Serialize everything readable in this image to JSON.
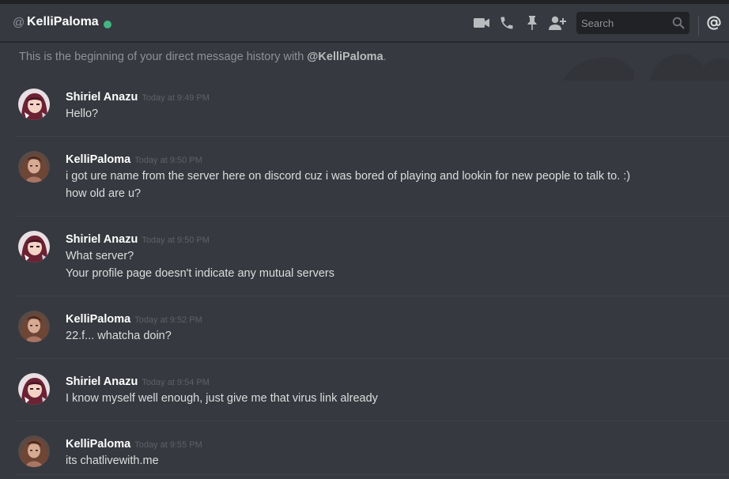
{
  "header": {
    "at_symbol": "@",
    "username": "KelliPaloma",
    "status_color": "#43b581",
    "icons": [
      "video-call-icon",
      "voice-call-icon",
      "pin-icon",
      "add-friend-icon",
      "mention-icon"
    ],
    "search_placeholder": "Search"
  },
  "intro": {
    "prefix": "This is the beginning of your direct message history with ",
    "mention": "@KelliPaloma",
    "suffix": "."
  },
  "messages": [
    {
      "author": "Shiriel Anazu",
      "timestamp": "Today at 9:49 PM",
      "lines": [
        "Hello?"
      ]
    },
    {
      "author": "KelliPaloma",
      "timestamp": "Today at 9:50 PM",
      "lines": [
        "i got ure name from the server here on discord cuz i was bored of playing and lookin for new people to talk to. :)",
        "how old are u?"
      ]
    },
    {
      "author": "Shiriel Anazu",
      "timestamp": "Today at 9:50 PM",
      "lines": [
        "What server?",
        "Your profile page doesn't indicate any mutual servers"
      ]
    },
    {
      "author": "KelliPaloma",
      "timestamp": "Today at 9:52 PM",
      "lines": [
        "22.f... whatcha doin?"
      ]
    },
    {
      "author": "Shiriel Anazu",
      "timestamp": "Today at 9:54 PM",
      "lines": [
        "I know myself well enough, just give me that virus link already"
      ]
    },
    {
      "author": "KelliPaloma",
      "timestamp": "Today at 9:55 PM",
      "lines": [
        "its chatlivewith.me"
      ]
    }
  ],
  "colors": {
    "background": "#36393f",
    "author": "#ffffff",
    "timestamp": "#5f6167",
    "message_text": "#dcddde",
    "online": "#43b581"
  }
}
